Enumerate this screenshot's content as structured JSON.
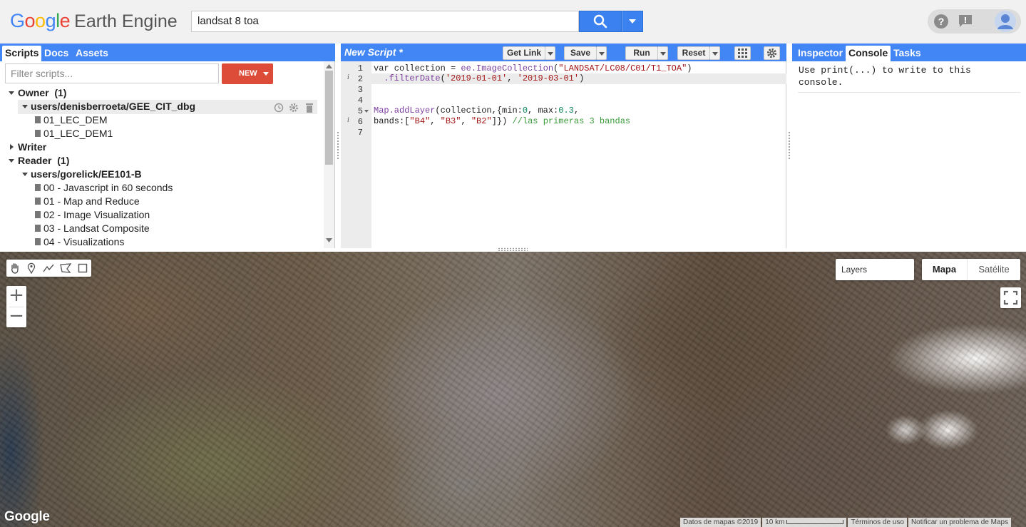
{
  "header": {
    "logo": {
      "google": "Google",
      "earth_engine": "Earth Engine"
    },
    "search": {
      "value": "landsat 8 toa"
    },
    "icons": [
      "help-icon",
      "feedback-icon",
      "account-avatar-icon"
    ]
  },
  "left_panel": {
    "tabs": [
      {
        "label": "Scripts",
        "active": true
      },
      {
        "label": "Docs",
        "active": false
      },
      {
        "label": "Assets",
        "active": false
      }
    ],
    "filter_placeholder": "Filter scripts...",
    "new_button": "NEW",
    "tree": {
      "owner": {
        "label": "Owner",
        "count": "(1)"
      },
      "owner_repo": "users/denisberroeta/GEE_CIT_dbg",
      "owner_files": [
        "01_LEC_DEM",
        "01_LEC_DEM1"
      ],
      "writer": {
        "label": "Writer"
      },
      "reader": {
        "label": "Reader",
        "count": "(1)"
      },
      "reader_repo": "users/gorelick/EE101-B",
      "reader_files": [
        "00 - Javascript in 60 seconds",
        "01 - Map and Reduce",
        "02 - Image Visualization",
        "03 - Landsat Composite",
        "04 - Visualizations"
      ]
    }
  },
  "editor": {
    "title": "New Script *",
    "buttons": {
      "get_link": "Get Link",
      "save": "Save",
      "run": "Run",
      "reset": "Reset"
    },
    "line_numbers": [
      "1",
      "2",
      "3",
      "4",
      "5",
      "6",
      "7"
    ],
    "code": {
      "l1_a": "var collection = ",
      "l1_b": "ee.ImageCollection",
      "l1_c": "(",
      "l1_d": "\"LANDSAT/LC08/C01/T1_TOA\"",
      "l1_e": ")",
      "l2_a": "  ",
      "l2_b": ".filterDate",
      "l2_c": "(",
      "l2_d": "'2019-01-01'",
      "l2_e": ", ",
      "l2_f": "'2019-03-01'",
      "l2_g": ")",
      "l5_a": "Map.addLayer",
      "l5_b": "(collection,{min:",
      "l5_c": "0",
      "l5_d": ", max:",
      "l5_e": "0.3",
      "l5_f": ",",
      "l6_a": "bands:[",
      "l6_b": "\"B4\"",
      "l6_c": ", ",
      "l6_d": "\"B3\"",
      "l6_e": ", ",
      "l6_f": "\"B2\"",
      "l6_g": "]}) ",
      "l6_h": "//las primeras 3 bandas"
    }
  },
  "console_panel": {
    "tabs": [
      {
        "label": "Inspector",
        "active": false
      },
      {
        "label": "Console",
        "active": true
      },
      {
        "label": "Tasks",
        "active": false
      }
    ],
    "message": "Use print(...) to write to this console."
  },
  "map": {
    "layers_label": "Layers",
    "map_types": [
      {
        "label": "Mapa",
        "active": true
      },
      {
        "label": "Satélite",
        "active": false
      }
    ],
    "zoom_in": "+",
    "zoom_out": "−",
    "google_mark": "Google",
    "attribution": {
      "data": "Datos de mapas ©2019",
      "scale": "10 km",
      "terms": "Términos de uso",
      "report": "Notificar un problema de Maps"
    }
  },
  "colors": {
    "accent_blue": "#4285f4",
    "new_button_red": "#dd4b39"
  }
}
